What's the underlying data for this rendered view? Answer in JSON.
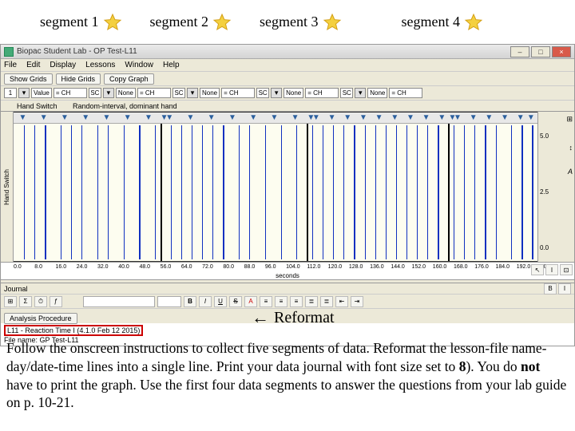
{
  "segment_labels": [
    "segment 1",
    "segment 2",
    "segment 3",
    "segment 4"
  ],
  "titlebar": {
    "title": "Biopac Student Lab - OP Test-L11"
  },
  "win_controls": {
    "min": "–",
    "max": "□",
    "close": "×"
  },
  "menubar": [
    "File",
    "Edit",
    "Display",
    "Lessons",
    "Window",
    "Help"
  ],
  "toolbar1": {
    "show_grid": "Show Grids",
    "hide_grid": "Hide Grids",
    "copy_graph": "Copy Graph"
  },
  "channels": [
    {
      "num": "1",
      "arrow": "▾",
      "mode": "Value",
      "readout": "= CH"
    },
    {
      "num": "SC",
      "arrow": "▾",
      "mode": "None",
      "readout": "= CH"
    },
    {
      "num": "SC",
      "arrow": "▾",
      "mode": "None",
      "readout": "= CH"
    },
    {
      "num": "SC",
      "arrow": "▾",
      "mode": "None",
      "readout": "= CH"
    },
    {
      "num": "SC",
      "arrow": "▾",
      "mode": "None",
      "readout": "= CH"
    }
  ],
  "label_bar": {
    "left": "Hand Switch",
    "text": "Random-interval, dominant hand"
  },
  "graph": {
    "y_left_label": "Hand Switch",
    "y_ticks": [
      {
        "v": "5.0",
        "pos": 30
      },
      {
        "v": "2.5",
        "pos": 100
      },
      {
        "v": "0.0",
        "pos": 170
      }
    ],
    "right_icons": [
      "⊞",
      "↕",
      "A"
    ],
    "x_ticks": [
      "0.0",
      "8.0",
      "16.0",
      "24.0",
      "32.0",
      "40.0",
      "48.0",
      "56.0",
      "64.0",
      "72.0",
      "80.0",
      "88.0",
      "96.0",
      "104.0",
      "112.0",
      "120.0",
      "128.0",
      "136.0",
      "144.0",
      "152.0",
      "160.0",
      "168.0",
      "176.0",
      "184.0",
      "192.0",
      "200.0"
    ],
    "x_label": "seconds",
    "markers_pct": [
      1,
      5,
      9,
      13,
      17,
      21,
      25,
      28,
      29,
      33,
      37,
      41,
      45,
      49,
      53,
      56,
      57,
      60,
      63,
      66,
      69,
      72,
      75,
      78,
      81,
      83,
      84,
      87,
      90,
      93,
      96,
      98
    ],
    "spikes_pct": [
      2,
      4,
      6,
      9,
      11,
      13,
      16,
      18,
      21,
      24,
      27,
      30,
      32,
      34,
      36,
      38,
      40,
      43,
      45,
      48,
      51,
      54,
      57,
      59,
      61,
      63,
      65,
      67,
      69,
      71,
      73,
      75,
      77,
      79,
      81,
      84,
      86,
      88,
      90,
      92,
      95,
      97,
      99
    ],
    "segment_divider_pct": [
      28,
      56,
      83
    ]
  },
  "journal": {
    "header": "Journal",
    "tabstop_btn": "⊞",
    "sigma": "Σ",
    "clock": "⏱",
    "formula": "ƒ",
    "font": "",
    "fontsize": "",
    "bold": "B",
    "italic": "I",
    "underline": "U",
    "strike": "S",
    "procedure_btn": "Analysis Procedure",
    "line1": "L11 - Reaction Time I (4.1.0 Feb 12 2015)",
    "line2": "File name: GP Test-L11"
  },
  "tool_icons": {
    "arrow": "↖",
    "ibeam": "I",
    "zoom": "⊡"
  },
  "reformat": {
    "arrow": "←",
    "label": "Reformat"
  },
  "instructions": {
    "p1a": "Follow the onscreen instructions to collect five segments of data.  Reformat the lesson-file name-day/date-time lines into a single line.  Print your data journal with font size set to ",
    "p1b": "8",
    "p1c": ").  You do ",
    "p1d": "not",
    "p1e": " have to print the graph.  Use the first four data segments to answer the questions from your lab guide on p. 10-21."
  }
}
